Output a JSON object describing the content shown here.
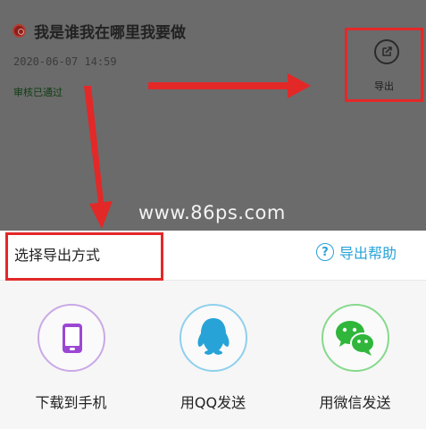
{
  "item": {
    "title": "我是谁我在哪里我要做",
    "date": "2020-06-07 14:59",
    "status": "审核已通过"
  },
  "export_button": {
    "label": "导出",
    "icon": "export-icon"
  },
  "watermark": "www.86ps.com",
  "sheet": {
    "title": "选择导出方式",
    "help_icon": "help-icon",
    "help_label": "导出帮助"
  },
  "options": [
    {
      "label": "下载到手机",
      "icon": "phone-icon",
      "color": "#9c47d4"
    },
    {
      "label": "用QQ发送",
      "icon": "qq-icon",
      "color": "#27a3d8"
    },
    {
      "label": "用微信发送",
      "icon": "wechat-icon",
      "color": "#2fb63b"
    }
  ],
  "colors": {
    "overlay": "#6b6b6b",
    "annotation_red": "#e32828",
    "status_green": "#0f3d12",
    "help_blue": "#27a3d8"
  }
}
